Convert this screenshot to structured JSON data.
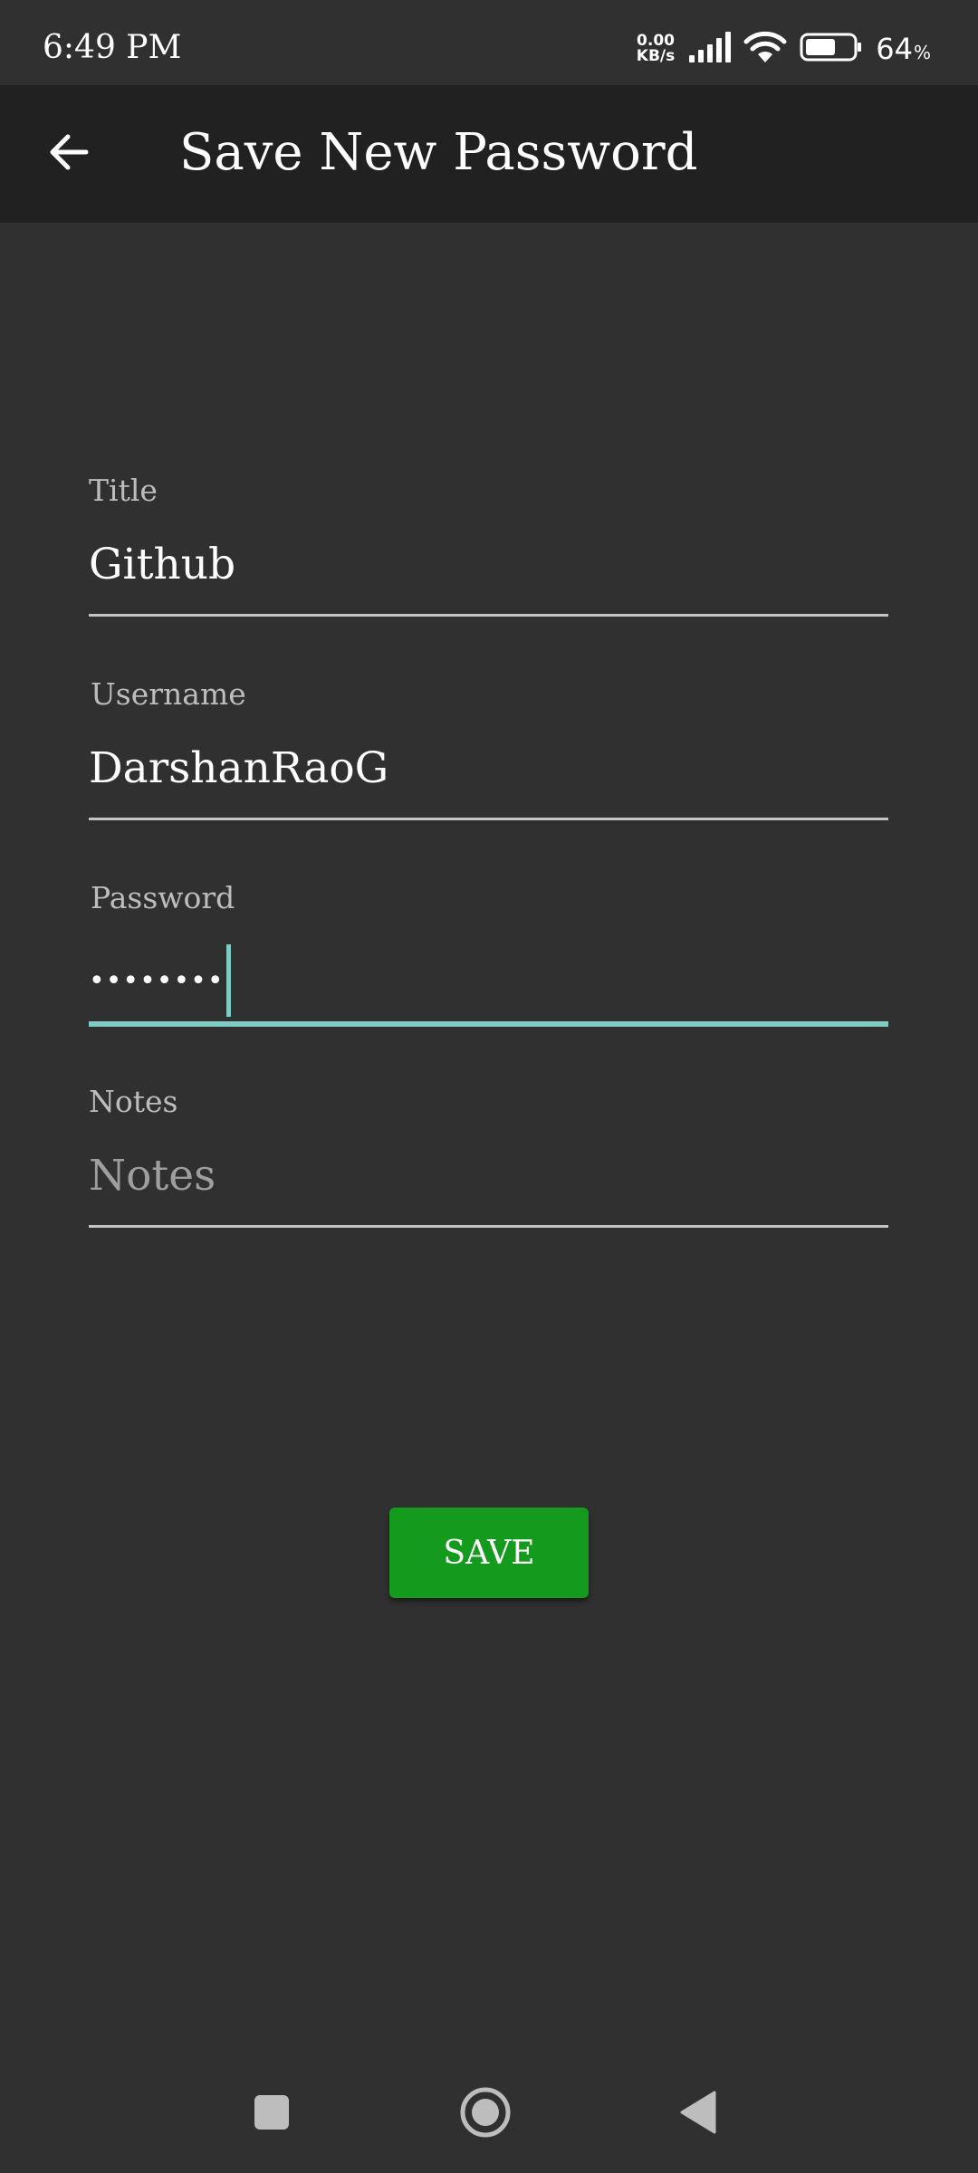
{
  "status_bar": {
    "time": "6:49 PM",
    "net_speed_value": "0.00",
    "net_speed_unit": "KB/s",
    "battery_percent": "64",
    "battery_sign": "%",
    "icons": [
      "signal-icon",
      "wifi-icon",
      "battery-icon"
    ]
  },
  "app_bar": {
    "title": "Save New Password",
    "back_icon": "arrow-back-icon"
  },
  "form": {
    "title_label": "Title",
    "title_value": "Github",
    "username_label": "Username",
    "username_value": "DarshanRaoG",
    "password_label": "Password",
    "password_masked": "••••••••",
    "notes_label": "Notes",
    "notes_placeholder": "Notes",
    "notes_value": ""
  },
  "save_button": {
    "label": "SAVE"
  },
  "nav_bar": {
    "icons": [
      "recents-icon",
      "home-icon",
      "back-icon"
    ]
  },
  "colors": {
    "background": "#303030",
    "app_bar": "#212121",
    "accent": "#80cbc4",
    "save_button": "#149a1c",
    "label": "#bdbdbd"
  }
}
